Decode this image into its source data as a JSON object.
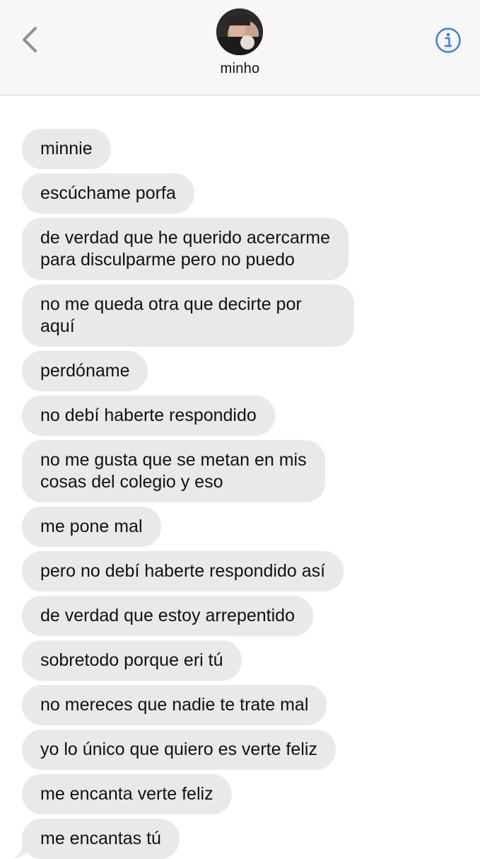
{
  "header": {
    "contact_name": "minho",
    "back_icon": "chevron-left-icon",
    "info_icon": "info-icon",
    "accent_color": "#3478f6"
  },
  "messages": [
    "minnie",
    "escúchame porfa",
    "de verdad que he querido acercarme\npara disculparme pero no puedo",
    "no me queda otra que decirte por aquí",
    "perdóname",
    "no debí haberte respondido",
    "no me gusta que se metan en mis\ncosas del colegio y eso",
    "me pone mal",
    "pero no debí haberte respondido así",
    "de verdad que estoy arrepentido",
    "sobretodo porque eri tú",
    "no mereces que nadie te trate mal",
    "yo lo único que quiero es verte feliz",
    "me encanta verte feliz",
    "me encantas tú"
  ],
  "colors": {
    "incoming_bubble": "#e9e9eb",
    "header_bg": "#f7f7f7",
    "text": "#111111"
  }
}
